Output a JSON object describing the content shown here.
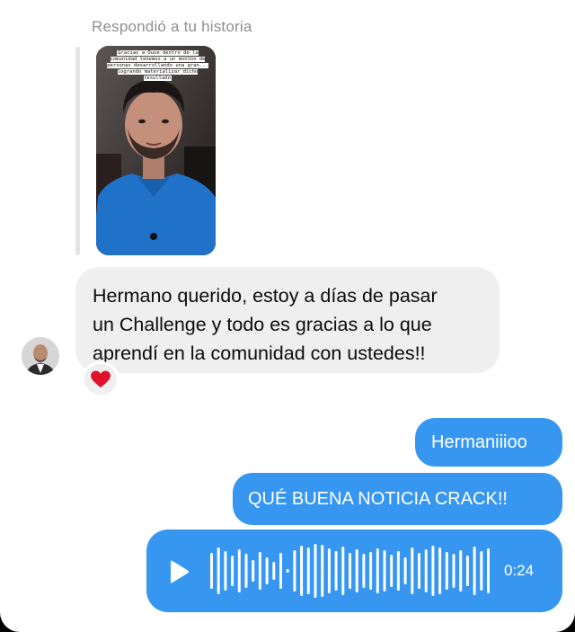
{
  "conversation": {
    "story_reply_caption": "Respondió a tu historia",
    "story_overlay_text": "Gracias a Ouse dentro de la comunidad tenemos a un montón de personas desarrollando una gran... logrando materializar dicho resultado",
    "incoming_message": {
      "lines": [
        "Hermano querido, estoy a días de pasar",
        "un Challenge y todo es gracias a lo que",
        "aprendí en la comunidad con ustedes!!"
      ],
      "reaction": "❤️"
    },
    "outgoing_messages": [
      "Hermaniiioo",
      "QUÉ BUENA NOTICIA CRACK!!"
    ],
    "voice_message": {
      "duration": "0:24",
      "icon": "play-icon"
    }
  },
  "colors": {
    "outgoing_bubble": "#3797f0",
    "incoming_bubble": "#efefef",
    "caption": "#8e8e93",
    "reaction_heart": "#e0112b"
  }
}
